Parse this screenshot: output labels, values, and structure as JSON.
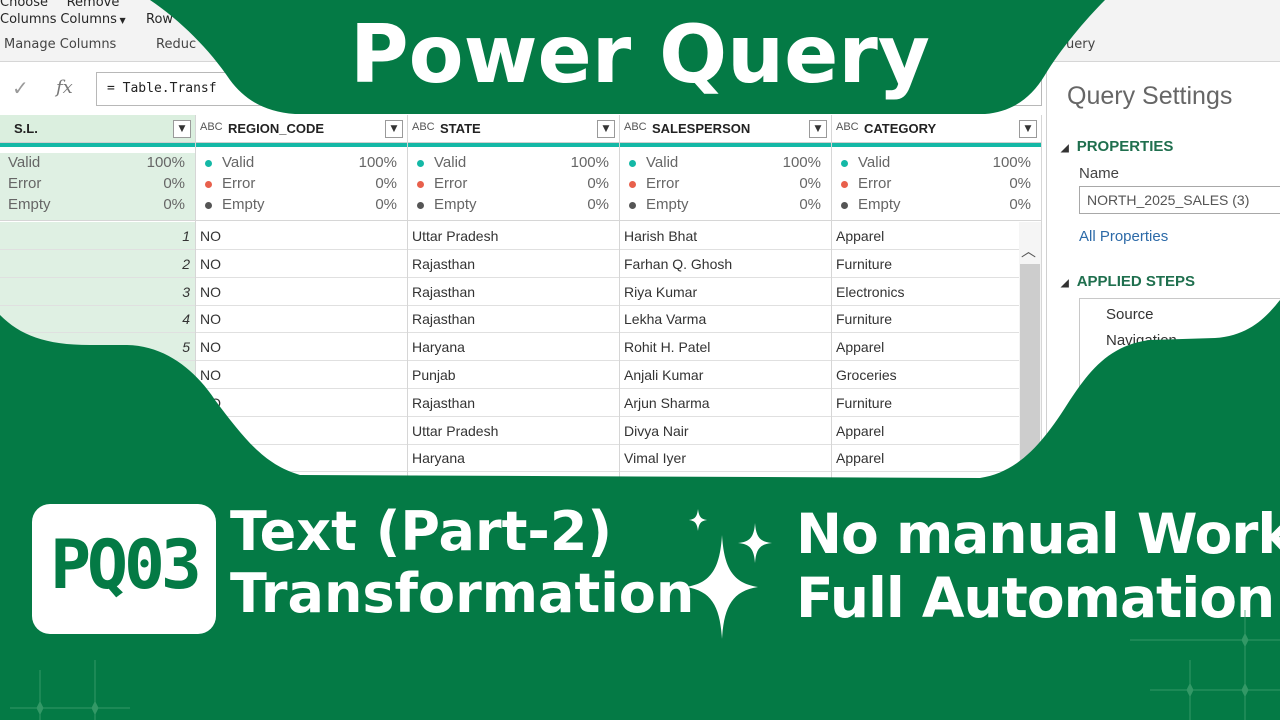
{
  "ribbon": {
    "buttons": [
      {
        "line1": "Choose",
        "line2": "Columns"
      },
      {
        "line1": "Remove",
        "line2": "Columns"
      }
    ],
    "truncated_button": "Row",
    "groups": [
      "Manage Columns",
      "Reduc"
    ],
    "right_group": "uery"
  },
  "formula_bar": {
    "check_icon": "check-icon",
    "fx_label": "fx",
    "formula": "= Table.Transf"
  },
  "columns": [
    {
      "type_icon": "3",
      "name": "S.L.",
      "selected": true,
      "numeric": true,
      "stats": {
        "valid": "100%",
        "error": "0%",
        "empty": "0%"
      },
      "values": [
        "1",
        "2",
        "3",
        "4",
        "5",
        "",
        "",
        "",
        ""
      ]
    },
    {
      "type_icon": "ABC",
      "name": "REGION_CODE",
      "selected": false,
      "numeric": false,
      "stats": {
        "valid": "100%",
        "error": "0%",
        "empty": "0%"
      },
      "values": [
        "NO",
        "NO",
        "NO",
        "NO",
        "NO",
        "NO",
        "NO",
        "",
        ""
      ]
    },
    {
      "type_icon": "ABC",
      "name": "STATE",
      "selected": false,
      "numeric": false,
      "stats": {
        "valid": "100%",
        "error": "0%",
        "empty": "0%"
      },
      "values": [
        "Uttar Pradesh",
        "Rajasthan",
        "Rajasthan",
        "Rajasthan",
        "Haryana",
        "Punjab",
        "Rajasthan",
        "Uttar Pradesh",
        "Haryana"
      ]
    },
    {
      "type_icon": "ABC",
      "name": "SALESPERSON",
      "selected": false,
      "numeric": false,
      "stats": {
        "valid": "100%",
        "error": "0%",
        "empty": "0%"
      },
      "values": [
        "Harish Bhat",
        "Farhan Q. Ghosh",
        "Riya Kumar",
        "Lekha Varma",
        "Rohit H. Patel",
        "Anjali Kumar",
        "Arjun Sharma",
        "Divya Nair",
        "Vimal Iyer"
      ]
    },
    {
      "type_icon": "ABC",
      "name": "CATEGORY",
      "selected": false,
      "numeric": false,
      "stats": {
        "valid": "100%",
        "error": "0%",
        "empty": "0%"
      },
      "values": [
        "Apparel",
        "Furniture",
        "Electronics",
        "Furniture",
        "Apparel",
        "Groceries",
        "Furniture",
        "Apparel",
        "Apparel"
      ]
    }
  ],
  "stat_labels": {
    "valid": "Valid",
    "error": "Error",
    "empty": "Empty"
  },
  "stat_colors": {
    "valid": "#14b8a6",
    "error": "#e8604c",
    "empty": "#555555"
  },
  "query_settings": {
    "title": "Query Settings",
    "properties_heading": "PROPERTIES",
    "name_label": "Name",
    "name_value": "NORTH_2025_SALES (3)",
    "all_properties": "All Properties",
    "applied_steps_heading": "APPLIED STEPS",
    "steps": [
      "Source",
      "Navigation"
    ]
  },
  "overlay": {
    "title": "Power Query",
    "badge": "PQ03",
    "topic_line1": "Text (Part-2)",
    "topic_line2": "Transformation",
    "tagline1": "No manual Work",
    "tagline2": "Full Automation",
    "sparkle_icon": "sparkle-icon"
  },
  "colors": {
    "brand_green": "#047a45",
    "white": "#ffffff",
    "selected_column": "#dbefdf",
    "link_blue": "#2c6aa8"
  }
}
